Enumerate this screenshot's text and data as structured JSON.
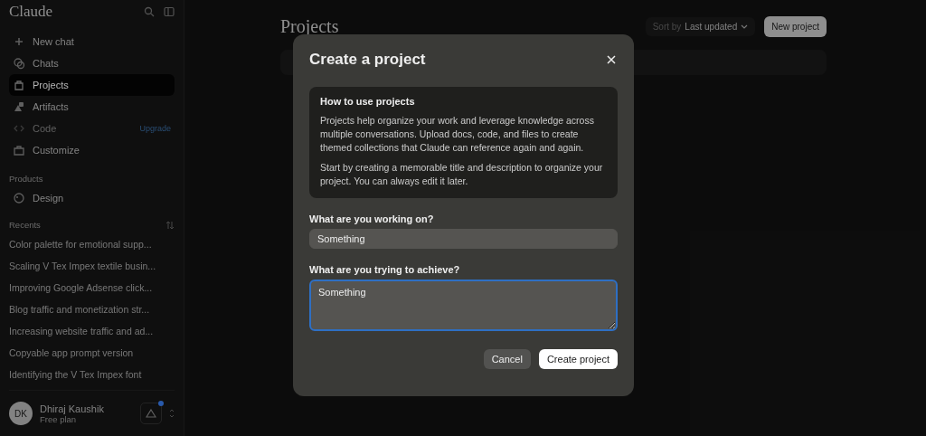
{
  "sidebar": {
    "logo": "Claude",
    "items": [
      {
        "label": "New chat",
        "selected": false,
        "disabled": false
      },
      {
        "label": "Chats",
        "selected": false,
        "disabled": false
      },
      {
        "label": "Projects",
        "selected": true,
        "disabled": false
      },
      {
        "label": "Artifacts",
        "selected": false,
        "disabled": false
      },
      {
        "label": "Code",
        "selected": false,
        "disabled": true,
        "badge": "Upgrade"
      },
      {
        "label": "Customize",
        "selected": false,
        "disabled": false
      }
    ],
    "products_heading": "Products",
    "products": [
      {
        "label": "Design"
      }
    ],
    "recents_heading": "Recents",
    "recents": [
      "Color palette for emotional supp...",
      "Scaling V Tex Impex textile busin...",
      "Improving Google Adsense click...",
      "Blog traffic and monetization str...",
      "Increasing website traffic and ad...",
      "Copyable app prompt version",
      "Identifying the V Tex Impex font"
    ],
    "user": {
      "initials": "DK",
      "name": "Dhiraj Kaushik",
      "plan": "Free plan",
      "notification": true
    }
  },
  "main": {
    "title": "Projects",
    "sort_label": "Sort by",
    "sort_value": "Last updated",
    "new_button": "New project"
  },
  "dialog": {
    "title": "Create a project",
    "info_heading": "How to use projects",
    "info_paragraphs": [
      "Projects help organize your work and leverage knowledge across multiple conversations. Upload docs, code, and files to create themed collections that Claude can reference again and again.",
      "Start by creating a memorable title and description to organize your project. You can always edit it later."
    ],
    "fields": [
      {
        "label": "What are you working on?",
        "value": "Something",
        "kind": "input",
        "focused": false
      },
      {
        "label": "What are you trying to achieve?",
        "value": "Something",
        "kind": "textarea",
        "focused": true
      }
    ],
    "cancel": "Cancel",
    "submit": "Create project"
  }
}
